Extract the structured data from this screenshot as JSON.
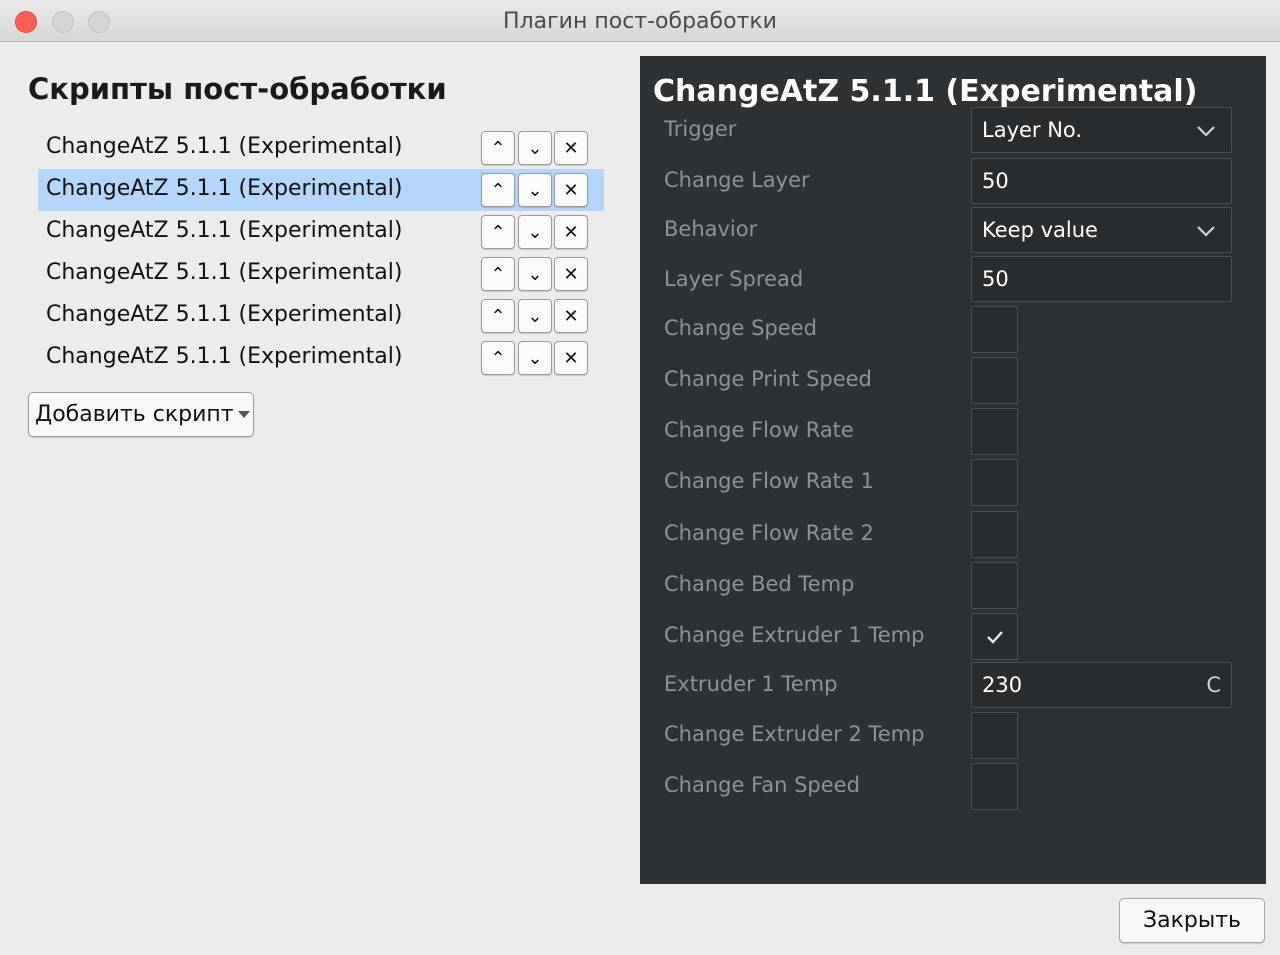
{
  "window": {
    "title": "Плагин пост-обработки"
  },
  "left_panel": {
    "heading": "Скрипты пост-обработки",
    "scripts": [
      {
        "name": "ChangeAtZ 5.1.1 (Experimental)",
        "selected": false
      },
      {
        "name": "ChangeAtZ 5.1.1 (Experimental)",
        "selected": true
      },
      {
        "name": "ChangeAtZ 5.1.1 (Experimental)",
        "selected": false
      },
      {
        "name": "ChangeAtZ 5.1.1 (Experimental)",
        "selected": false
      },
      {
        "name": "ChangeAtZ 5.1.1 (Experimental)",
        "selected": false
      },
      {
        "name": "ChangeAtZ 5.1.1 (Experimental)",
        "selected": false
      }
    ],
    "row_icons": {
      "up": "chevron-up-icon",
      "down": "chevron-down-icon",
      "remove": "close-icon"
    },
    "add_script_label": "Добавить скрипт"
  },
  "settings": {
    "title": "ChangeAtZ 5.1.1 (Experimental)",
    "trigger": {
      "label": "Trigger",
      "value": "Layer No."
    },
    "change_layer": {
      "label": "Change Layer",
      "value": "50"
    },
    "behavior": {
      "label": "Behavior",
      "value": "Keep value"
    },
    "layer_spread": {
      "label": "Layer Spread",
      "value": "50"
    },
    "change_speed": {
      "label": "Change Speed",
      "checked": false
    },
    "change_print_speed": {
      "label": "Change Print Speed",
      "checked": false
    },
    "change_flow_rate": {
      "label": "Change Flow Rate",
      "checked": false
    },
    "change_flow_rate_1": {
      "label": "Change Flow Rate 1",
      "checked": false
    },
    "change_flow_rate_2": {
      "label": "Change Flow Rate 2",
      "checked": false
    },
    "change_bed_temp": {
      "label": "Change Bed Temp",
      "checked": false
    },
    "change_extruder_1_temp": {
      "label": "Change Extruder 1 Temp",
      "checked": true
    },
    "extruder_1_temp": {
      "label": "Extruder 1 Temp",
      "value": "230",
      "unit": "C"
    },
    "change_extruder_2_temp": {
      "label": "Change Extruder 2 Temp",
      "checked": false
    },
    "change_fan_speed": {
      "label": "Change Fan Speed",
      "checked": false
    }
  },
  "footer": {
    "close_label": "Закрыть"
  },
  "colors": {
    "panel_background": "#2e3235",
    "selection": "#b5d5fb",
    "label_text": "#8f9396",
    "close_traffic_light": "#fd5f57"
  }
}
